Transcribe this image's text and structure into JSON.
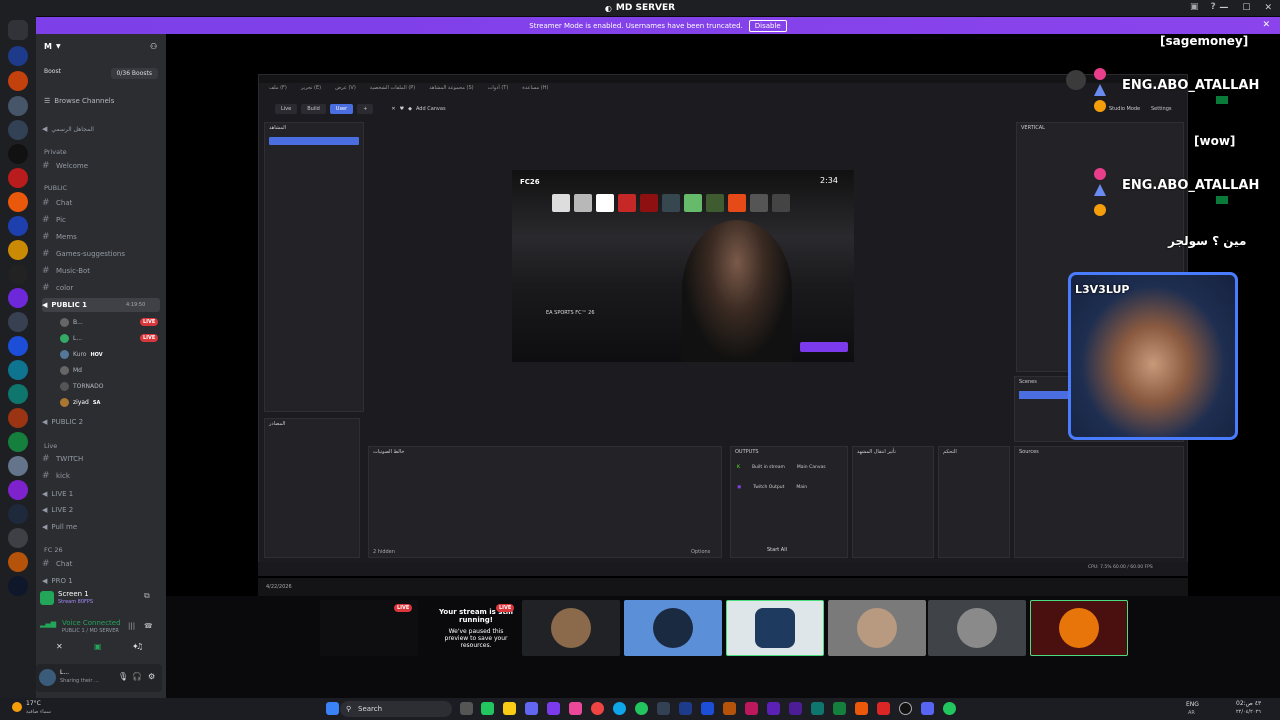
{
  "titlebar": {
    "title": "MD SERVER"
  },
  "banner": {
    "text": "Streamer Mode is enabled. Usernames have been truncated.",
    "disable_label": "Disable",
    "close": "✕"
  },
  "sidebar": {
    "server_initial": "M",
    "boost_label": "Boost",
    "boosts_count": "0/36 Boosts",
    "browse_channels": "Browse Channels",
    "channels": [
      {
        "label": "المجاهل الرسمي",
        "type": "voice"
      },
      {
        "label": "Private",
        "type": "category"
      },
      {
        "label": "Welcome",
        "type": "text"
      },
      {
        "label": "PUBLIC",
        "type": "category"
      },
      {
        "label": "Chat",
        "type": "text"
      },
      {
        "label": "Pic",
        "type": "text"
      },
      {
        "label": "Mems",
        "type": "text"
      },
      {
        "label": "Games-suggestions",
        "type": "text"
      },
      {
        "label": "Music-Bot",
        "type": "text"
      },
      {
        "label": "color",
        "type": "text"
      },
      {
        "label": "PUBLIC 1",
        "type": "voice",
        "time": "4:19:50"
      },
      {
        "label": "PUBLIC 2",
        "type": "voice"
      },
      {
        "label": "Live",
        "type": "category"
      },
      {
        "label": "TWITCH",
        "type": "text"
      },
      {
        "label": "kick",
        "type": "text"
      },
      {
        "label": "LIVE 1",
        "type": "voice"
      },
      {
        "label": "LIVE 2",
        "type": "voice"
      },
      {
        "label": "Pull me",
        "type": "voice"
      },
      {
        "label": "FC 26",
        "type": "category"
      },
      {
        "label": "Chat",
        "type": "text"
      },
      {
        "label": "PRO 1",
        "type": "voice"
      }
    ],
    "voice_users": [
      "B...",
      "L...",
      "Kuro",
      "Md",
      "TORNADO",
      "ziyad"
    ],
    "user_tags": [
      "HOV",
      "SA"
    ],
    "live_label": "LIVE",
    "screen_title": "Screen 1",
    "screen_sub": "Stream 80FPS",
    "voice_connected": "Voice Connected",
    "voice_channel": "PUBLIC 1 / MD SERVER",
    "user_name": "L...",
    "user_status": "Sharing their ..."
  },
  "overlay": {
    "chat": [
      {
        "text": "[sagemoney]"
      },
      {
        "text": "ENG.ABO_ATALLAH"
      },
      {
        "text": "[wow]"
      },
      {
        "text": "ENG.ABO_ATALLAH"
      },
      {
        "text": "مين ؟ سولجر"
      }
    ],
    "cam_label": "L3V3LUP"
  },
  "obs": {
    "menu": [
      "ملف (F)",
      "تحرير (E)",
      "عرض (V)",
      "الملفات الشخصية (P)",
      "مجموعة المشاهد (S)",
      "أدوات (T)",
      "مساعدة (H)"
    ],
    "toolbar": [
      "Live",
      "Build",
      "User",
      "Add Canvas"
    ],
    "scenes_title": "المشاهد",
    "sources_title": "المصادر",
    "mixer_title": "خالط الصوتيات",
    "outputs_title": "OUTPUTS",
    "outputs": [
      "Built in stream",
      "Twitch Output"
    ],
    "output_canvas": [
      "Main Canvas",
      "Main"
    ],
    "transition_title": "تأثير انتقال المشهد",
    "controls_title": "التحكم",
    "vertical_title": "VERTICAL",
    "scenes_right": "Scenes",
    "sources_right": "Sources",
    "start_all": "Start All",
    "options": "Options",
    "hidden": "2 hidden",
    "studio_mode": "Studio Mode",
    "settings": "Settings",
    "status": "CPU: 7.5%   60.00 / 60.00 FPS",
    "zoom": "45%",
    "resolution": "(1080x1920)",
    "date": "4/22/2026"
  },
  "preview": {
    "time": "2:34",
    "brand": "FC26",
    "game": "EA SPORTS FC™ 26"
  },
  "thumbs": {
    "live_label": "LIVE",
    "paused_title": "Your stream is still running!",
    "paused_sub": "We've paused this preview to save your resources."
  },
  "taskbar": {
    "weather": "17°C",
    "weather_sub": "سماء صافية",
    "search": "Search",
    "lang": "ENG",
    "lang2": "AR",
    "time": "02:٤٣ ص",
    "date": "٢٢/٠٤/٢٠٢٦"
  },
  "colors": {
    "banner": "#7c3fe8",
    "accent": "#5865f2",
    "live": "#da373c",
    "cam_border": "#4a7cff"
  }
}
